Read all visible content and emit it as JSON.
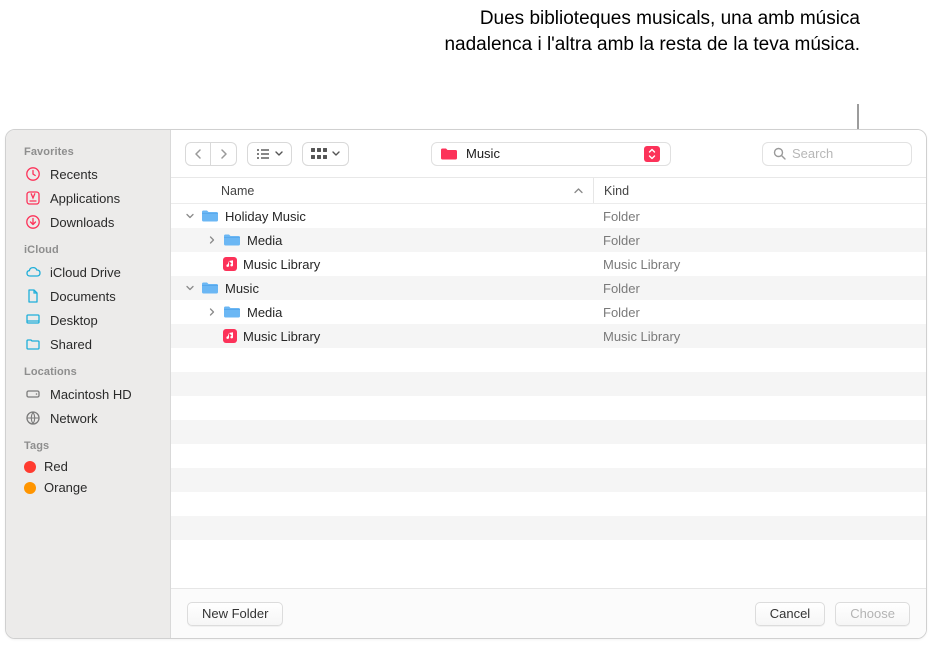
{
  "caption": "Dues biblioteques musicals, una amb música nadalenca i l'altra amb la resta de la teva música.",
  "sidebar": {
    "favorites": {
      "title": "Favorites",
      "items": [
        "Recents",
        "Applications",
        "Downloads"
      ]
    },
    "icloud": {
      "title": "iCloud",
      "items": [
        "iCloud Drive",
        "Documents",
        "Desktop",
        "Shared"
      ]
    },
    "locations": {
      "title": "Locations",
      "items": [
        "Macintosh HD",
        "Network"
      ]
    },
    "tags": {
      "title": "Tags",
      "items": [
        "Red",
        "Orange"
      ]
    }
  },
  "toolbar": {
    "location": "Music",
    "search_placeholder": "Search"
  },
  "columns": {
    "name": "Name",
    "kind": "Kind"
  },
  "rows": [
    {
      "indent": 0,
      "disclosure": "down",
      "icon": "folder",
      "name": "Holiday Music",
      "kind": "Folder"
    },
    {
      "indent": 1,
      "disclosure": "right",
      "icon": "folder",
      "name": "Media",
      "kind": "Folder"
    },
    {
      "indent": 1,
      "disclosure": "none",
      "icon": "library",
      "name": "Music Library",
      "kind": "Music Library"
    },
    {
      "indent": 0,
      "disclosure": "down",
      "icon": "folder",
      "name": "Music",
      "kind": "Folder"
    },
    {
      "indent": 1,
      "disclosure": "right",
      "icon": "folder",
      "name": "Media",
      "kind": "Folder"
    },
    {
      "indent": 1,
      "disclosure": "none",
      "icon": "library",
      "name": "Music Library",
      "kind": "Music Library"
    }
  ],
  "footer": {
    "new_folder": "New Folder",
    "cancel": "Cancel",
    "choose": "Choose"
  }
}
